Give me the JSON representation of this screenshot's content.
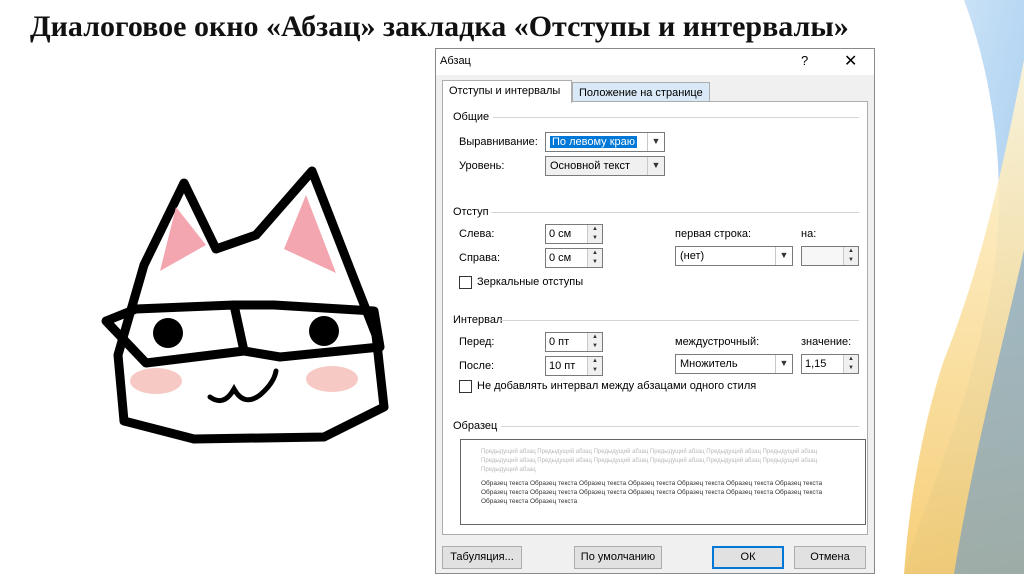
{
  "slide": {
    "title": "Диалоговое окно «Абзац» закладка «Отступы и интервалы»"
  },
  "dialog": {
    "title": "Абзац",
    "help_label": "?",
    "close_label": "✕",
    "tabs": [
      {
        "label": "Отступы и интервалы",
        "active": true
      },
      {
        "label": "Положение на странице",
        "active": false
      }
    ],
    "general": {
      "heading": "Общие",
      "alignment_label": "Выравнивание:",
      "alignment_value": "По левому краю",
      "level_label": "Уровень:",
      "level_value": "Основной текст"
    },
    "indent": {
      "heading": "Отступ",
      "left_label": "Слева:",
      "left_value": "0 см",
      "right_label": "Справа:",
      "right_value": "0 см",
      "first_line_label": "первая строка:",
      "first_line_value": "(нет)",
      "by_label": "на:",
      "by_value": "",
      "mirror_label": "Зеркальные отступы",
      "mirror_checked": false
    },
    "spacing": {
      "heading": "Интервал",
      "before_label": "Перед:",
      "before_value": "0 пт",
      "after_label": "После:",
      "after_value": "10 пт",
      "line_spacing_label": "междустрочный:",
      "line_spacing_value": "Множитель",
      "at_label": "значение:",
      "at_value": "1,15",
      "no_space_label": "Не добавлять интервал между абзацами одного стиля",
      "no_space_checked": false
    },
    "preview": {
      "heading": "Образец",
      "prev_lines": [
        "Предыдущий абзац Предыдущий абзац Предыдущий абзац Предыдущий абзац Предыдущий абзац Предыдущий абзац",
        "Предыдущий абзац Предыдущий абзац Предыдущий абзац Предыдущий абзац Предыдущий абзац Предыдущий абзац",
        "Предыдущий абзац"
      ],
      "sample_lines": [
        "Образец текста Образец текста Образец текста Образец текста Образец текста Образец текста Образец текста",
        "Образец текста Образец текста Образец текста Образец текста Образец текста Образец текста Образец текста",
        "Образец текста Образец текста"
      ]
    },
    "buttons": {
      "tabs_label": "Табуляция...",
      "default_label": "По умолчанию",
      "ok_label": "ОК",
      "cancel_label": "Отмена"
    }
  },
  "colors": {
    "accent": "#0078d7",
    "inactive_tab": "#d9e9f7",
    "cat_ear": "#f4a6b0",
    "cat_cheek": "#f6c9c4"
  }
}
